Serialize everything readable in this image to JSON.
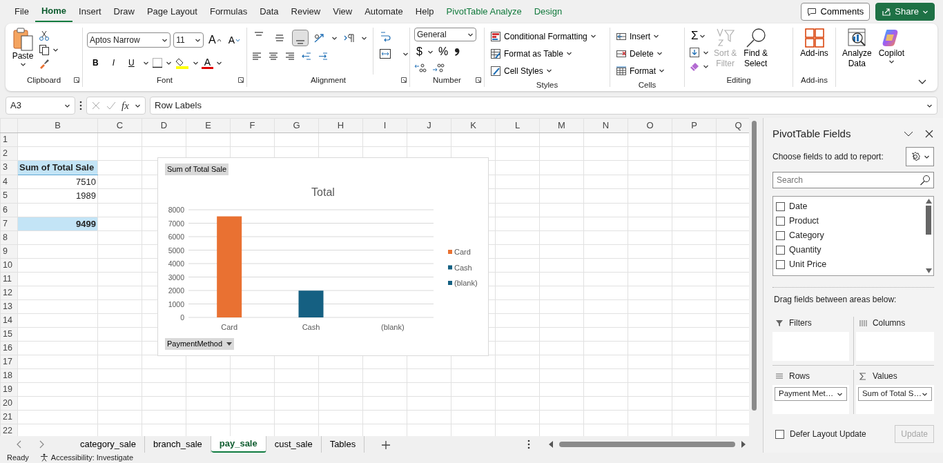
{
  "menu_tabs": [
    {
      "label": "File",
      "selected": false,
      "kind": "normal"
    },
    {
      "label": "Home",
      "selected": true,
      "kind": "normal"
    },
    {
      "label": "Insert",
      "selected": false,
      "kind": "normal"
    },
    {
      "label": "Draw",
      "selected": false,
      "kind": "normal"
    },
    {
      "label": "Page Layout",
      "selected": false,
      "kind": "normal"
    },
    {
      "label": "Formulas",
      "selected": false,
      "kind": "normal"
    },
    {
      "label": "Data",
      "selected": false,
      "kind": "normal"
    },
    {
      "label": "Review",
      "selected": false,
      "kind": "normal"
    },
    {
      "label": "View",
      "selected": false,
      "kind": "normal"
    },
    {
      "label": "Automate",
      "selected": false,
      "kind": "normal"
    },
    {
      "label": "Help",
      "selected": false,
      "kind": "normal"
    },
    {
      "label": "PivotTable Analyze",
      "selected": false,
      "kind": "contextual"
    },
    {
      "label": "Design",
      "selected": false,
      "kind": "contextual"
    }
  ],
  "header_buttons": [
    {
      "label": "Comments",
      "kind": "outline"
    },
    {
      "label": "Share",
      "kind": "primary"
    }
  ],
  "ribbon": {
    "clipboard": {
      "label": "Clipboard",
      "paste": "Paste"
    },
    "font": {
      "label": "Font",
      "font_name": "Aptos Narrow",
      "font_size": "11",
      "grow": "A",
      "shrink": "A",
      "bold": "B",
      "italic": "I",
      "underline": "U",
      "font_color": "A"
    },
    "alignment": {
      "label": "Alignment",
      "vertical": [
        {
          "selected": false
        },
        {
          "selected": false
        },
        {
          "selected": true
        }
      ]
    },
    "number": {
      "label": "Number",
      "format": "General",
      "currency": "$",
      "percent": "%"
    },
    "styles": {
      "label": "Styles",
      "buttons": [
        "Conditional Formatting",
        "Format as Table",
        "Cell Styles"
      ]
    },
    "cells": {
      "label": "Cells",
      "buttons": [
        "Insert",
        "Delete",
        "Format"
      ]
    },
    "editing": {
      "label": "Editing",
      "autosum": "Σ",
      "sort_filter": {
        "label": "Sort &\nFilter",
        "disabled": true
      },
      "find_select": "Find &\nSelect"
    },
    "addins": {
      "label": "Add-ins",
      "button": "Add-ins"
    },
    "analysis": [
      "Analyze\nData",
      "Copilot"
    ]
  },
  "formula_bar": {
    "name_box": "A3",
    "fx": "fx",
    "formula": "Row Labels"
  },
  "sheet": {
    "columns": [
      "B",
      "C",
      "D",
      "E",
      "F",
      "G",
      "H",
      "I",
      "J",
      "K",
      "L",
      "M",
      "N",
      "O",
      "P",
      "Q"
    ],
    "rows": [
      {
        "header": "1"
      },
      {
        "header": "2"
      },
      {
        "header": "3",
        "cells": [
          {
            "text": "Sum of Total Sale",
            "kind": "pivot-header"
          }
        ]
      },
      {
        "header": "4",
        "cells": [
          {
            "text": "7510",
            "kind": "value"
          }
        ]
      },
      {
        "header": "5",
        "cells": [
          {
            "text": "1989",
            "kind": "value"
          }
        ]
      },
      {
        "header": "6"
      },
      {
        "header": "7",
        "cells": [
          {
            "text": "9499",
            "kind": "grand-total"
          }
        ]
      },
      {
        "header": "8"
      },
      {
        "header": "9"
      },
      {
        "header": "10"
      },
      {
        "header": "11"
      },
      {
        "header": "12"
      },
      {
        "header": "13"
      },
      {
        "header": "14"
      },
      {
        "header": "15"
      },
      {
        "header": "16"
      },
      {
        "header": "17"
      },
      {
        "header": "18"
      },
      {
        "header": "19"
      },
      {
        "header": "20"
      },
      {
        "header": "21"
      },
      {
        "header": "22"
      }
    ]
  },
  "chart": {
    "value_button": "Sum of Total Sale",
    "axis_button": "PaymentMethod",
    "chart_data": {
      "type": "bar",
      "title": "Total",
      "categories": [
        "Card",
        "Cash",
        "(blank)"
      ],
      "series": [
        {
          "name": "Card",
          "color": "#e97132",
          "values": [
            7510,
            null,
            null
          ]
        },
        {
          "name": "Cash",
          "color": "#156082",
          "values": [
            null,
            1989,
            null
          ]
        },
        {
          "name": "(blank)",
          "color": "#156082",
          "values": [
            null,
            null,
            null
          ]
        }
      ],
      "legend": "right",
      "grid": true,
      "ylim": [
        0,
        8000
      ],
      "yticks": [
        0,
        1000,
        2000,
        3000,
        4000,
        5000,
        6000,
        7000,
        8000
      ]
    }
  },
  "sheet_tabs": [
    {
      "label": "category_sale",
      "selected": false
    },
    {
      "label": "branch_sale",
      "selected": false
    },
    {
      "label": "pay_sale",
      "selected": true
    },
    {
      "label": "cust_sale",
      "selected": false
    },
    {
      "label": "Tables",
      "selected": false
    }
  ],
  "pivot_panel": {
    "title": "PivotTable Fields",
    "subtitle": "Choose fields to add to report:",
    "search": {
      "placeholder": "Search"
    },
    "fields": [
      {
        "label": "Date",
        "checked": false
      },
      {
        "label": "Product",
        "checked": false
      },
      {
        "label": "Category",
        "checked": false
      },
      {
        "label": "Quantity",
        "checked": false
      },
      {
        "label": "Unit Price",
        "checked": false
      }
    ],
    "areas_hint": "Drag fields between areas below:",
    "areas": [
      {
        "label": "Filters",
        "kind": "filters"
      },
      {
        "label": "Columns",
        "kind": "columns"
      },
      {
        "label": "Rows",
        "kind": "rows",
        "items": [
          "Payment Met…"
        ]
      },
      {
        "label": "Values",
        "kind": "values",
        "items": [
          "Sum of Total S…"
        ]
      }
    ],
    "defer": {
      "label": "Defer Layout Update",
      "checked": false
    },
    "update": {
      "label": "Update",
      "disabled": true
    }
  },
  "status_bar": {
    "mode": "Ready",
    "accessibility": "Accessibility: Investigate"
  }
}
